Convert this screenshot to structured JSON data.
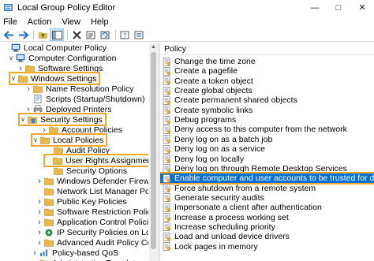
{
  "window": {
    "title": "Local Group Policy Editor"
  },
  "menu": [
    "File",
    "Action",
    "View",
    "Help"
  ],
  "toolbar": [
    "back-icon",
    "forward-icon",
    "up-folder-icon",
    "show-hide-tree-icon",
    "delete-icon",
    "properties-icon",
    "refresh-icon",
    "help-icon",
    "view-icon"
  ],
  "tree": [
    {
      "label": "Local Computer Policy",
      "icon": "computer-icon",
      "chevron": "",
      "highlight": false
    },
    {
      "label": "Computer Configuration",
      "icon": "computer-icon",
      "chevron": "v",
      "highlight": false
    },
    {
      "label": "Software Settings",
      "icon": "folder-icon",
      "chevron": ">",
      "highlight": false
    },
    {
      "label": "Windows Settings",
      "icon": "folder-icon",
      "chevron": "v",
      "highlight": true
    },
    {
      "label": "Name Resolution Policy",
      "icon": "folder-icon",
      "chevron": ">",
      "highlight": false
    },
    {
      "label": "Scripts (Startup/Shutdown)",
      "icon": "script-icon",
      "chevron": "",
      "highlight": false
    },
    {
      "label": "Deployed Printers",
      "icon": "printer-icon",
      "chevron": ">",
      "highlight": false
    },
    {
      "label": "Security Settings",
      "icon": "security-folder-icon",
      "chevron": "v",
      "highlight": true
    },
    {
      "label": "Account Policies",
      "icon": "folder-icon",
      "chevron": ">",
      "highlight": false
    },
    {
      "label": "Local Policies",
      "icon": "folder-icon",
      "chevron": "v",
      "highlight": true
    },
    {
      "label": "Audit Policy",
      "icon": "folder-icon",
      "chevron": "",
      "highlight": false
    },
    {
      "label": "User Rights Assignment",
      "icon": "folder-icon",
      "chevron": "",
      "highlight": true
    },
    {
      "label": "Security Options",
      "icon": "folder-icon",
      "chevron": "",
      "highlight": false
    },
    {
      "label": "Windows Defender Firewall with A",
      "icon": "folder-icon",
      "chevron": ">",
      "highlight": false
    },
    {
      "label": "Network List Manager Policies",
      "icon": "folder-icon",
      "chevron": "",
      "highlight": false
    },
    {
      "label": "Public Key Policies",
      "icon": "folder-icon",
      "chevron": ">",
      "highlight": false
    },
    {
      "label": "Software Restriction Policies",
      "icon": "folder-icon",
      "chevron": ">",
      "highlight": false
    },
    {
      "label": "Application Control Policies",
      "icon": "folder-icon",
      "chevron": ">",
      "highlight": false
    },
    {
      "label": "IP Security Policies on Local Com",
      "icon": "ipsec-icon",
      "chevron": ">",
      "highlight": false
    },
    {
      "label": "Advanced Audit Policy Configu",
      "icon": "folder-icon",
      "chevron": ">",
      "highlight": false
    },
    {
      "label": "Policy-based QoS",
      "icon": "qos-icon",
      "chevron": ">",
      "highlight": false
    },
    {
      "label": "Administrative Templates",
      "icon": "folder-icon",
      "chevron": ">",
      "highlight": false
    }
  ],
  "right": {
    "column_header": "Policy",
    "policies": [
      {
        "label": "Change the time zone",
        "selected": false
      },
      {
        "label": "Create a pagefile",
        "selected": false
      },
      {
        "label": "Create a token object",
        "selected": false
      },
      {
        "label": "Create global objects",
        "selected": false
      },
      {
        "label": "Create permanent shared objects",
        "selected": false
      },
      {
        "label": "Create symbolic links",
        "selected": false
      },
      {
        "label": "Debug programs",
        "selected": false
      },
      {
        "label": "Deny access to this computer from the network",
        "selected": false
      },
      {
        "label": "Deny log on as a batch job",
        "selected": false
      },
      {
        "label": "Deny log on as a service",
        "selected": false
      },
      {
        "label": "Deny log on locally",
        "selected": false
      },
      {
        "label": "Deny log on through Remote Desktop Services",
        "selected": false
      },
      {
        "label": "Enable computer and user accounts to be trusted for delegation",
        "selected": true
      },
      {
        "label": "Force shutdown from a remote system",
        "selected": false
      },
      {
        "label": "Generate security audits",
        "selected": false
      },
      {
        "label": "Impersonate a client after authentication",
        "selected": false
      },
      {
        "label": "Increase a process working set",
        "selected": false
      },
      {
        "label": "Increase scheduling priority",
        "selected": false
      },
      {
        "label": "Load and unload device drivers",
        "selected": false
      },
      {
        "label": "Lock pages in memory",
        "selected": false
      }
    ]
  },
  "colors": {
    "selection": "#0a6fd6",
    "highlight_outline": "#f0a92a",
    "folder": "#e8b84a"
  }
}
